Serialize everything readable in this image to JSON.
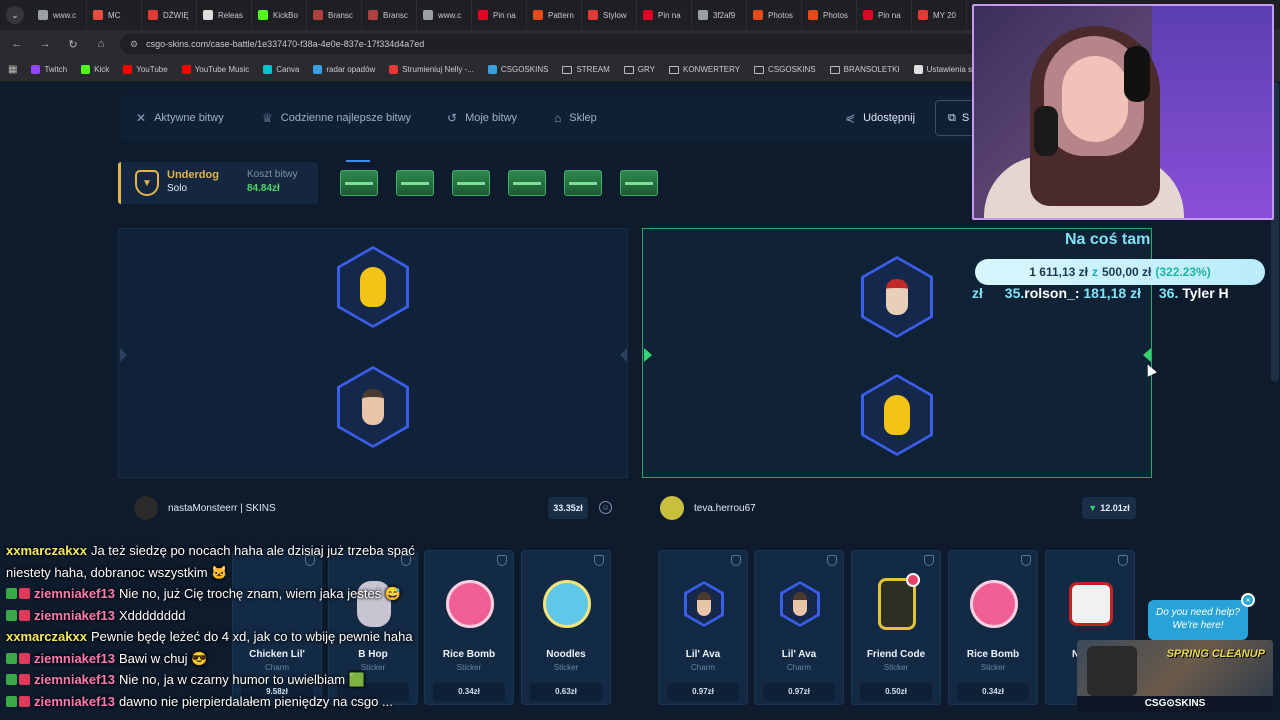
{
  "browser": {
    "tabs": [
      {
        "label": "www.c",
        "color": "#9aa0a6"
      },
      {
        "label": "MC",
        "color": "#e74c3c"
      },
      {
        "label": "DŹWIĘ",
        "color": "#e53935"
      },
      {
        "label": "Releas",
        "color": "#dddddd"
      },
      {
        "label": "KickBo",
        "color": "#53fc18"
      },
      {
        "label": "Bransc",
        "color": "#b04040"
      },
      {
        "label": "Bransc",
        "color": "#b04040"
      },
      {
        "label": "www.c",
        "color": "#9aa0a6"
      },
      {
        "label": "Pin na",
        "color": "#e60023"
      },
      {
        "label": "Pattern",
        "color": "#e64a19"
      },
      {
        "label": "Stylow",
        "color": "#e53935"
      },
      {
        "label": "Pin na",
        "color": "#e60023"
      },
      {
        "label": "3f2af9",
        "color": "#9aa0a6"
      },
      {
        "label": "Photos",
        "color": "#e64a19"
      },
      {
        "label": "Photos",
        "color": "#e64a19"
      },
      {
        "label": "Pin na",
        "color": "#e60023"
      },
      {
        "label": "MY 20",
        "color": "#e53935"
      }
    ],
    "url": "csgo-skins.com/case-battle/1e337470-f38a-4e0e-837e-17f334d4a7ed",
    "bookmarks": [
      {
        "label": "Twitch",
        "icon": "twitch-icon",
        "color": "#9146ff"
      },
      {
        "label": "Kick",
        "icon": "kick-icon",
        "color": "#53fc18"
      },
      {
        "label": "YouTube",
        "icon": "youtube-icon",
        "color": "#ff0000"
      },
      {
        "label": "YouTube Music",
        "icon": "youtube-music-icon",
        "color": "#ff0000"
      },
      {
        "label": "Canva",
        "icon": "canva-icon",
        "color": "#00c4cc"
      },
      {
        "label": "radar opadów",
        "icon": "radar-icon",
        "color": "#3aa0e0"
      },
      {
        "label": "Strumieniuj Nelly -...",
        "icon": "stream-icon",
        "color": "#e53935"
      },
      {
        "label": "CSGOSKINS",
        "icon": "csgoskins-icon",
        "color": "#3aa0e0"
      },
      {
        "label": "STREAM",
        "icon": "folder-icon",
        "color": ""
      },
      {
        "label": "GRY",
        "icon": "folder-icon",
        "color": ""
      },
      {
        "label": "KONWERTERY",
        "icon": "folder-icon",
        "color": ""
      },
      {
        "label": "CSGOSKINS",
        "icon": "folder-icon",
        "color": ""
      },
      {
        "label": "BRANSOLETKI",
        "icon": "folder-icon",
        "color": ""
      },
      {
        "label": "Ustawienia strumien...",
        "icon": "settings-site-icon",
        "color": "#e0e0e0"
      }
    ]
  },
  "nav": {
    "active_battles": "Aktywne bitwy",
    "daily_best": "Codzienne najlepsze bitwy",
    "my_battles": "Moje bitwy",
    "shop": "Sklep",
    "share": "Udostępnij",
    "cut_button": "S"
  },
  "battle": {
    "mode": "Underdog",
    "type": "Solo",
    "cost_label": "Koszt bitwy",
    "cost_value": "84.84zł",
    "crate_count": 6
  },
  "players": [
    {
      "name": "nastaMonsteerr | SKINS",
      "total": "33.35zł",
      "items": [
        {
          "name": "Chicken Lil'",
          "type": "Charm",
          "price": "9.58zł"
        },
        {
          "name": "B Hop",
          "type": "Sticker",
          "price": ""
        },
        {
          "name": "Rice Bomb",
          "type": "Sticker",
          "price": "0.34zł"
        },
        {
          "name": "Noodles",
          "type": "Sticker",
          "price": "0.63zł"
        }
      ]
    },
    {
      "name": "teva.herrou67",
      "total": "12.01zł",
      "items": [
        {
          "name": "Lil' Ava",
          "type": "Charm",
          "price": "0.97zł"
        },
        {
          "name": "Lil' Ava",
          "type": "Charm",
          "price": "0.97zł"
        },
        {
          "name": "Friend Code",
          "type": "Sticker",
          "price": "0.50zł"
        },
        {
          "name": "Rice Bomb",
          "type": "Sticker",
          "price": "0.34zł"
        },
        {
          "name": "N",
          "type": "",
          "price": ""
        }
      ]
    }
  ],
  "overlay": {
    "goal_title": "Na coś tam",
    "goal_current": "1 611,13 zł",
    "goal_sep": "z",
    "goal_target": "500,00 zł",
    "goal_percent": "(322.23%)",
    "ticker_lead": "zł",
    "ticker_rank1": "35.",
    "ticker_name1": "rolson_:",
    "ticker_amount1": "181,18 zł",
    "ticker_rank2": "36.",
    "ticker_name2": "Tyler H",
    "help_line1": "Do you need help?",
    "help_line2": "We're here!",
    "promo_title": "SPRING CLEANUP",
    "promo_brand": "CSG⊙SKINS"
  },
  "chat": [
    {
      "user": "xxmarczakxx",
      "color": "n-x",
      "badges": [],
      "text": "Ja też siedzę po nocach haha ale dzisiaj już trzeba spać"
    },
    {
      "user": "",
      "color": "",
      "badges": [],
      "text": "niestety haha, dobranoc wszystkim 🐱"
    },
    {
      "user": "ziemniakef13",
      "color": "n-z",
      "badges": [
        "#3aa94a",
        "#e03a5a"
      ],
      "text": "Nie no, już Cię trochę znam, wiem jaka jesteś 😅"
    },
    {
      "user": "ziemniakef13",
      "color": "n-z",
      "badges": [
        "#3aa94a",
        "#e03a5a"
      ],
      "text": "Xdddddddd"
    },
    {
      "user": "xxmarczakxx",
      "color": "n-x",
      "badges": [],
      "text": "Pewnie będę leżeć do 4 xd, jak co to wbiję pewnie haha"
    },
    {
      "user": "ziemniakef13",
      "color": "n-z",
      "badges": [
        "#3aa94a",
        "#e03a5a"
      ],
      "text": "Bawi w chuj 😎"
    },
    {
      "user": "ziemniakef13",
      "color": "n-z",
      "badges": [
        "#3aa94a",
        "#e03a5a"
      ],
      "text": "Nie no, ja w czarny humor to uwielbiam 🟩"
    },
    {
      "user": "ziemniakef13",
      "color": "n-z",
      "badges": [
        "#3aa94a",
        "#e03a5a"
      ],
      "text": "dawno nie pierpierdalałem pieniędzy na csgo ..."
    }
  ]
}
